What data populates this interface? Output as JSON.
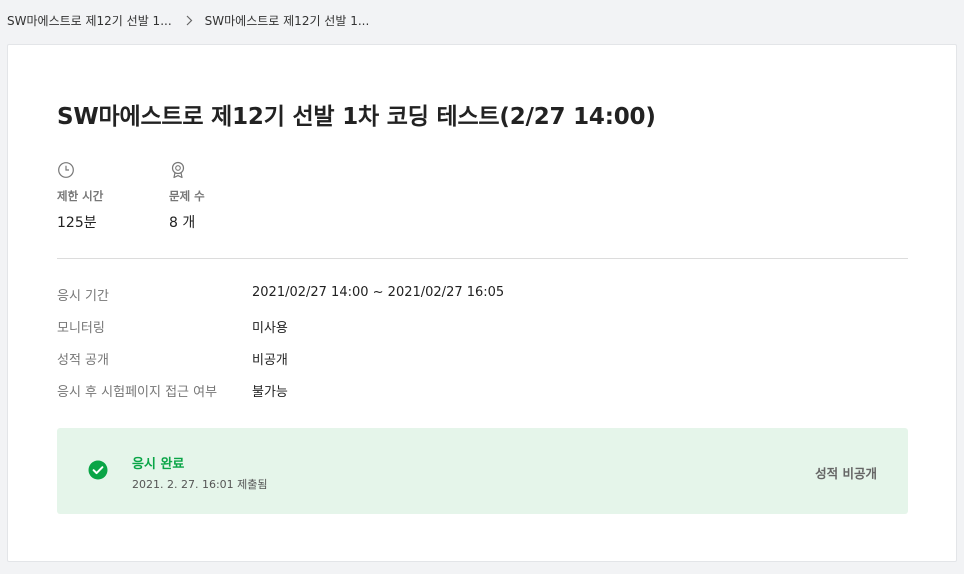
{
  "breadcrumb": {
    "items": [
      "SW마에스트로 제12기 선발 1...",
      "SW마에스트로 제12기 선발 1..."
    ],
    "separator_icon": "chevron-right-icon"
  },
  "test": {
    "title": "SW마에스트로 제12기 선발 1차 코딩 테스트(2/27 14:00)"
  },
  "stats": [
    {
      "icon": "clock-icon",
      "label": "제한 시간",
      "value": "125분"
    },
    {
      "icon": "medal-icon",
      "label": "문제 수",
      "value": "8 개"
    }
  ],
  "info": [
    {
      "key": "응시 기간",
      "value": "2021/02/27 14:00 ~ 2021/02/27 16:05"
    },
    {
      "key": "모니터링",
      "value": "미사용"
    },
    {
      "key": "성적 공개",
      "value": "비공개"
    },
    {
      "key": "응시 후 시험페이지 접근 여부",
      "value": "불가능"
    }
  ],
  "status": {
    "icon": "check-circle-icon",
    "title": "응시 완료",
    "submitted": "2021. 2. 27. 16:01 제출됨",
    "grade": "성적 비공개",
    "accent_color": "#0aa547",
    "background_color": "#e5f5ea"
  }
}
